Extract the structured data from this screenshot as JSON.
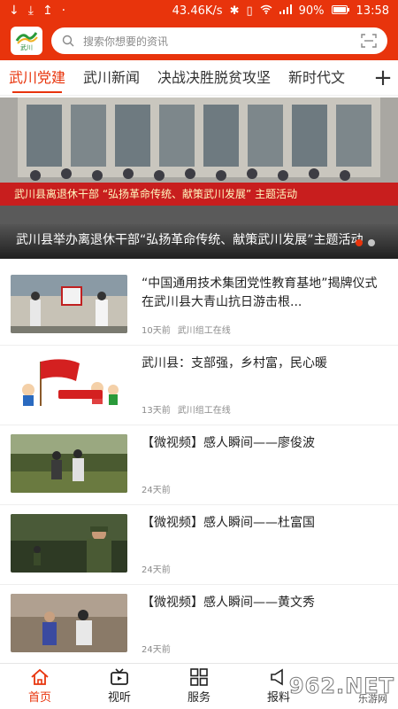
{
  "status_bar": {
    "left_icons": [
      "download-icon",
      "download-icon",
      "upload-icon",
      "dot-icon"
    ],
    "speed": "43.46K/s",
    "battery": "90%",
    "time": "13:58"
  },
  "header": {
    "logo_text": "武川",
    "search_placeholder": "搜索你想要的资讯"
  },
  "tabs": [
    {
      "label": "武川党建",
      "active": true
    },
    {
      "label": "武川新闻",
      "active": false
    },
    {
      "label": "决战决胜脱贫攻坚",
      "active": false
    },
    {
      "label": "新时代文",
      "active": false
    }
  ],
  "tab_add": "+",
  "banner": {
    "red_banner_text": "武川县离退休干部 “弘扬革命传统、献策武川发展” 主题活动",
    "caption": "武川县举办离退休干部“弘扬革命传统、献策武川发展”主题活动",
    "page_count": 2,
    "active_page": 1
  },
  "news": [
    {
      "title": "“中国通用技术集团党性教育基地”揭牌仪式在武川县大青山抗日游击根...",
      "time": "10天前",
      "source": "武川组工在线"
    },
    {
      "title": "武川县：支部强，乡村富，民心暖",
      "time": "13天前",
      "source": "武川组工在线"
    },
    {
      "title": "【微视频】感人瞬间——廖俊波",
      "time": "24天前",
      "source": ""
    },
    {
      "title": "【微视频】感人瞬间——杜富国",
      "time": "24天前",
      "source": ""
    },
    {
      "title": "【微视频】感人瞬间——黄文秀",
      "time": "24天前",
      "source": ""
    }
  ],
  "bottom_nav": [
    {
      "label": "首页",
      "icon": "home-icon",
      "active": true
    },
    {
      "label": "视听",
      "icon": "tv-icon",
      "active": false
    },
    {
      "label": "服务",
      "icon": "grid-icon",
      "active": false
    },
    {
      "label": "报料",
      "icon": "megaphone-icon",
      "active": false
    }
  ],
  "watermark": {
    "main": "962.NET",
    "sub": "乐游网"
  },
  "colors": {
    "accent": "#e8340c"
  }
}
